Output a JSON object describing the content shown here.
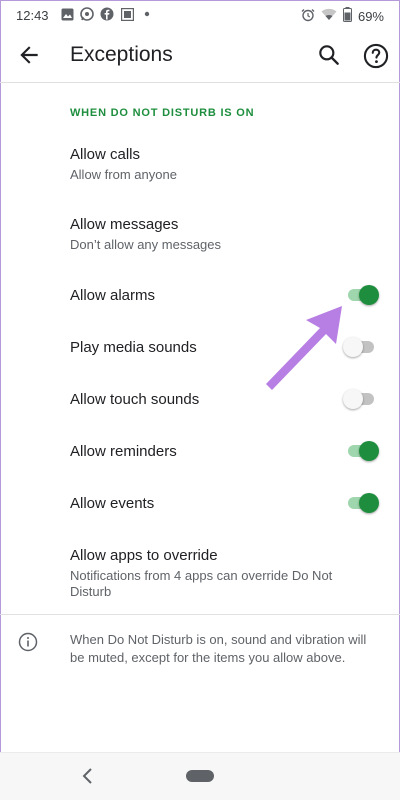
{
  "status_bar": {
    "time": "12:43",
    "battery": "69%",
    "left_icons": [
      "gallery-icon",
      "whatsapp-icon",
      "facebook-icon",
      "notification-icon",
      "dot-icon"
    ],
    "right_icons": [
      "alarm-icon",
      "wifi-icon",
      "battery-icon"
    ]
  },
  "app_bar": {
    "title": "Exceptions",
    "back_icon": "arrow-left-icon",
    "search_icon": "search-icon",
    "help_icon": "help-icon"
  },
  "section_header": "WHEN DO NOT DISTURB IS ON",
  "items": [
    {
      "label": "Allow calls",
      "subtitle": "Allow from anyone"
    },
    {
      "label": "Allow messages",
      "subtitle": "Don’t allow any messages"
    },
    {
      "label": "Allow alarms",
      "toggle": true
    },
    {
      "label": "Play media sounds",
      "toggle": false
    },
    {
      "label": "Allow touch sounds",
      "toggle": false
    },
    {
      "label": "Allow reminders",
      "toggle": true
    },
    {
      "label": "Allow events",
      "toggle": true
    },
    {
      "label": "Allow apps to override",
      "subtitle": "Notifications from 4 apps can override Do Not Disturb"
    }
  ],
  "footer_info": "When Do Not Disturb is on, sound and vibration will be muted, except for the items you allow above.",
  "colors": {
    "accent": "#1e8e3e",
    "annotation_arrow": "#b77ee3"
  }
}
